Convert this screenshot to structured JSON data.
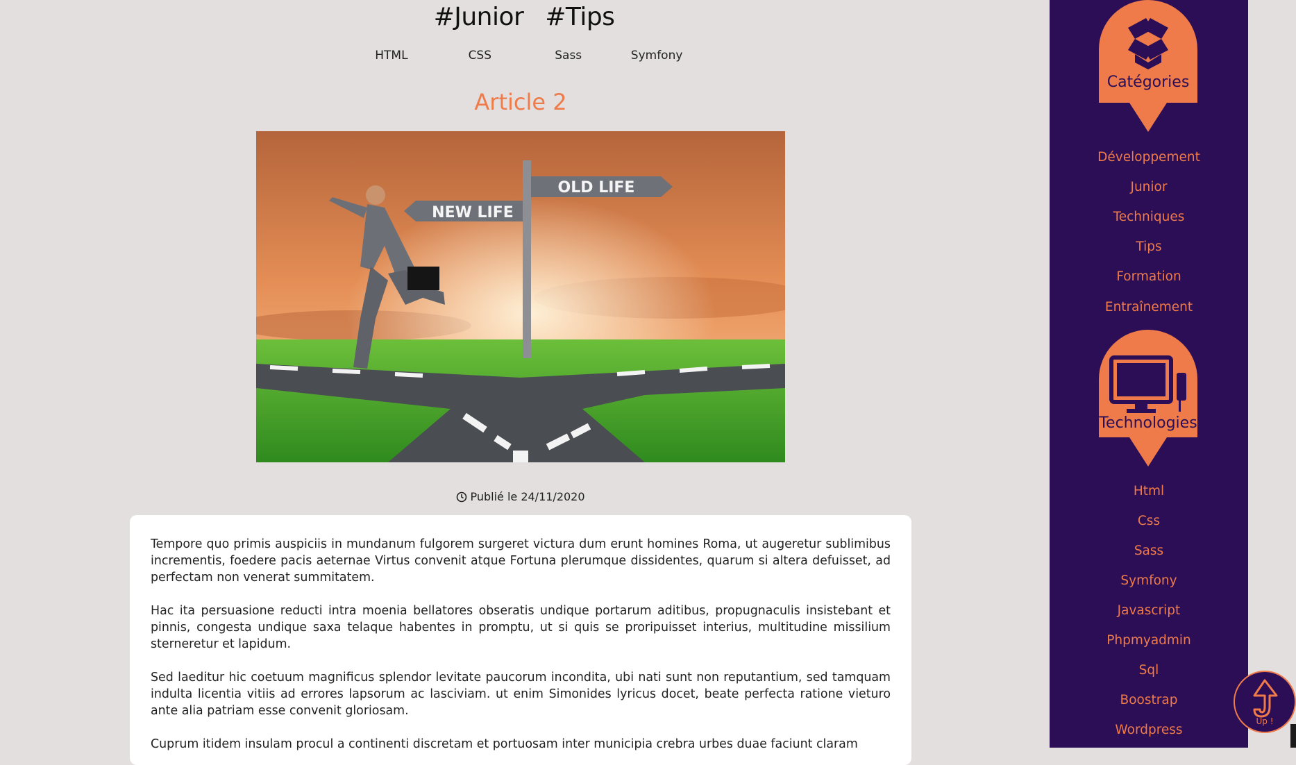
{
  "header": {
    "hashtags": [
      "#Junior",
      "#Tips"
    ],
    "tech_links": [
      "HTML",
      "CSS",
      "Sass",
      "Symfony"
    ]
  },
  "article": {
    "title": "Article 2",
    "image": {
      "sign_new": "NEW LIFE",
      "sign_old": "OLD LIFE"
    },
    "published": "Publié le 24/11/2020",
    "paragraphs": [
      "Tempore quo primis auspiciis in mundanum fulgorem surgeret victura dum erunt homines Roma, ut augeretur sublimibus incrementis, foedere pacis aeternae Virtus convenit atque Fortuna plerumque dissidentes, quarum si altera defuisset, ad perfectam non venerat summitatem.",
      "Hac ita persuasione reducti intra moenia bellatores obseratis undique portarum aditibus, propugnaculis insistebant et pinnis, congesta undique saxa telaque habentes in promptu, ut si quis se proripuisset interius, multitudine missilium sterneretur et lapidum.",
      "Sed laeditur hic coetuum magnificus splendor levitate paucorum incondita, ubi nati sunt non reputantium, sed tamquam indulta licentia vitiis ad errores lapsorum ac lasciviam. ut enim Simonides lyricus docet, beate perfecta ratione vieturo ante alia patriam esse convenit gloriosam.",
      "Cuprum itidem insulam procul a continenti discretam et portuosam inter municipia crebra urbes duae faciunt claram"
    ]
  },
  "sidebar": {
    "categories_title": "Catégories",
    "categories": [
      "Développement",
      "Junior",
      "Techniques",
      "Tips",
      "Formation",
      "Entraînement"
    ],
    "technologies_title": "Technologies",
    "technologies": [
      "Html",
      "Css",
      "Sass",
      "Symfony",
      "Javascript",
      "Phpmyadmin",
      "Sql",
      "Boostrap",
      "Wordpress"
    ]
  },
  "up_button": {
    "label": "Up !",
    "icon": "up-arrow-icon"
  },
  "colors": {
    "accent": "#ef7b4a",
    "sidebar": "#2b0e56",
    "background": "#e2dfde"
  }
}
